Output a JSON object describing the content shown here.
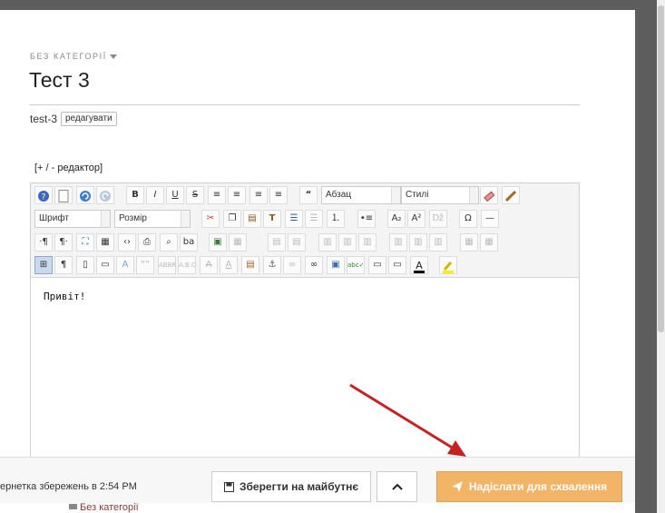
{
  "post": {
    "category": "БЕЗ КАТЕГОРІЇ",
    "title": "Тест 3",
    "slug": "test-3",
    "edit_label": "редагувати"
  },
  "editor": {
    "toggle_label": "[+ / - редактор]",
    "format_combo": "Абзац",
    "styles_combo": "Стилі",
    "font_combo": "Шрифт",
    "size_combo": "Розмір",
    "content": "Привіт!",
    "icons": {
      "row1": [
        "help-icon",
        "new-page-icon",
        "undo-icon",
        "redo-icon",
        "bold-icon",
        "italic-icon",
        "underline-icon",
        "strikethrough-icon",
        "align-justify-icon",
        "align-center-icon",
        "align-left-icon",
        "align-right-icon",
        "blockquote-icon",
        "eraser-icon",
        "brush-icon"
      ],
      "row2": [
        "cut-icon",
        "copy-icon",
        "paste-icon",
        "paste-text-icon",
        "indent-icon",
        "outdent-icon",
        "numbered-list-icon",
        "bullet-list-icon",
        "subscript-icon",
        "superscript-icon",
        "spellcheck-icon",
        "special-char-icon",
        "horizontal-rule-icon"
      ],
      "row3": [
        "ltr-icon",
        "rtl-icon",
        "fullscreen-icon",
        "template-icon",
        "source-icon",
        "print-icon",
        "find-icon",
        "replace-icon",
        "image-icon",
        "table-icon",
        "column-icon",
        "grid-icon"
      ],
      "row4": [
        "select-all-icon",
        "paragraph-mark-icon",
        "preview-icon",
        "iframe-icon",
        "text-style-icon",
        "quote-icon",
        "abbr-icon",
        "acronym-icon",
        "del-icon",
        "ins-icon",
        "attach-icon",
        "anchor-icon",
        "unlink-icon",
        "link-icon",
        "image-insert-icon",
        "spell-icon",
        "div-icon",
        "box-icon",
        "text-color-icon",
        "highlight-icon"
      ]
    },
    "text_colors": {
      "text_color": "#000000",
      "highlight_color": "#ffee00"
    }
  },
  "footer": {
    "status": "ернетка збережень в 2:54 PM",
    "save_label": "Зберегти на майбутнє",
    "send_label": "Надіслати для схвалення"
  },
  "below": {
    "category_link": "Без категорії"
  },
  "colors": {
    "accent": "#f2b466",
    "arrow": "#c62222"
  }
}
